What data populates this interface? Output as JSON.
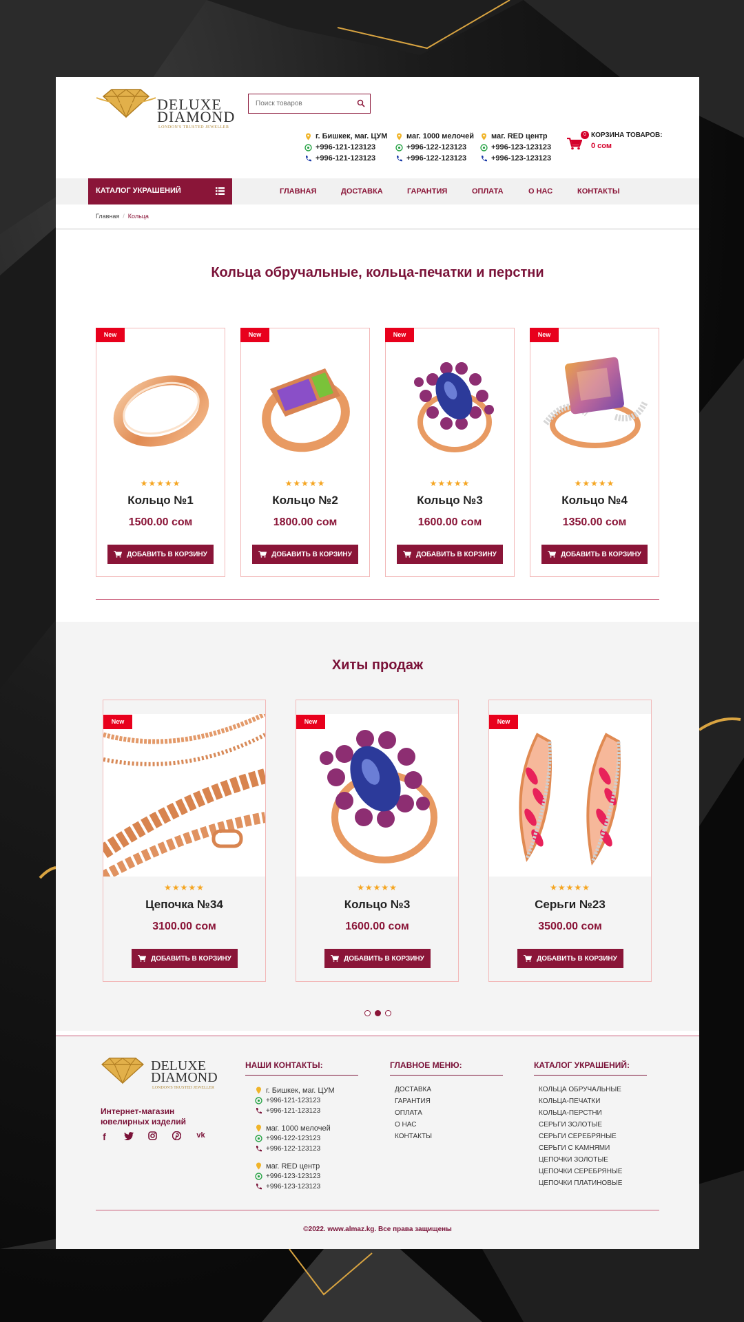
{
  "header": {
    "logo": {
      "line1": "DELUXE",
      "line2": "DIAMOND",
      "tagline": "LONDON'S TRUSTED JEWELLER"
    },
    "search_placeholder": "Поиск товаров",
    "stores": [
      {
        "address": "г. Бишкек, маг. ЦУМ",
        "whatsapp": "+996-121-123123",
        "phone": "+996-121-123123"
      },
      {
        "address": "маг. 1000 мелочей",
        "whatsapp": "+996-122-123123",
        "phone": "+996-122-123123"
      },
      {
        "address": "маг. RED центр",
        "whatsapp": "+996-123-123123",
        "phone": "+996-123-123123"
      }
    ],
    "cart": {
      "count": "0",
      "title": "КОРЗИНА ТОВАРОВ:",
      "sum": "0 сом"
    }
  },
  "nav": {
    "catalog_label": "КАТАЛОГ УКРАШЕНИЙ",
    "items": [
      "ГЛАВНАЯ",
      "ДОСТАВКА",
      "ГАРАНТИЯ",
      "ОПЛАТА",
      "О НАС",
      "КОНТАКТЫ"
    ]
  },
  "breadcrumb": {
    "home": "Главная",
    "current": "Кольца"
  },
  "rings_section": {
    "title": "Кольца обручальные, кольца-печатки и перстни",
    "products": [
      {
        "badge": "New",
        "name": "Кольцо №1",
        "price": "1500.00 сом",
        "rating": 5,
        "button": "ДОБАВИТЬ В КОРЗИНУ"
      },
      {
        "badge": "New",
        "name": "Кольцо №2",
        "price": "1800.00 сом",
        "rating": 5,
        "button": "ДОБАВИТЬ В КОРЗИНУ"
      },
      {
        "badge": "New",
        "name": "Кольцо №3",
        "price": "1600.00 сом",
        "rating": 5,
        "button": "ДОБАВИТЬ В КОРЗИНУ"
      },
      {
        "badge": "New",
        "name": "Кольцо №4",
        "price": "1350.00 сом",
        "rating": 5,
        "button": "ДОБАВИТЬ В КОРЗИНУ"
      }
    ]
  },
  "hits_section": {
    "title": "Хиты продаж",
    "products": [
      {
        "badge": "New",
        "name": "Цепочка №34",
        "price": "3100.00 сом",
        "rating": 5,
        "button": "ДОБАВИТЬ В КОРЗИНУ"
      },
      {
        "badge": "New",
        "name": "Кольцо №3",
        "price": "1600.00 сом",
        "rating": 5,
        "button": "ДОБАВИТЬ В КОРЗИНУ"
      },
      {
        "badge": "New",
        "name": "Серьги №23",
        "price": "3500.00 сом",
        "rating": 5,
        "button": "ДОБАВИТЬ В КОРЗИНУ"
      }
    ],
    "carousel_pages": 3,
    "carousel_active": 2
  },
  "footer": {
    "tagline_line1": "Интернет-магазин",
    "tagline_line2": "ювелирных изделий",
    "socials": [
      "facebook-icon",
      "twitter-icon",
      "instagram-icon",
      "pinterest-icon",
      "vk-icon"
    ],
    "contacts_title": "НАШИ КОНТАКТЫ:",
    "menu_title": "ГЛАВНОЕ МЕНЮ:",
    "menu_items": [
      "ДОСТАВКА",
      "ГАРАНТИЯ",
      "ОПЛАТА",
      "О НАС",
      "КОНТАКТЫ"
    ],
    "catalog_title": "КАТАЛОГ УКРАШЕНИЙ:",
    "catalog_items": [
      "КОЛЬЦА ОБРУЧАЛЬНЫЕ",
      "КОЛЬЦА-ПЕЧАТКИ",
      "КОЛЬЦА-ПЕРСТНИ",
      "СЕРЬГИ ЗОЛОТЫЕ",
      "СЕРЬГИ СЕРЕБРЯНЫЕ",
      "СЕРЬГИ С КАМНЯМИ",
      "ЦЕПОЧКИ ЗОЛОТЫЕ",
      "ЦЕПОЧКИ СЕРЕБРЯНЫЕ",
      "ЦЕПОЧКИ ПЛАТИНОВЫЕ"
    ],
    "copyright": "©2022. www.almaz.kg. Все права защищены"
  },
  "colors": {
    "brand": "#8a1538",
    "badge": "#e8001c",
    "stars": "#f5a623",
    "gold": "#d9a441"
  }
}
